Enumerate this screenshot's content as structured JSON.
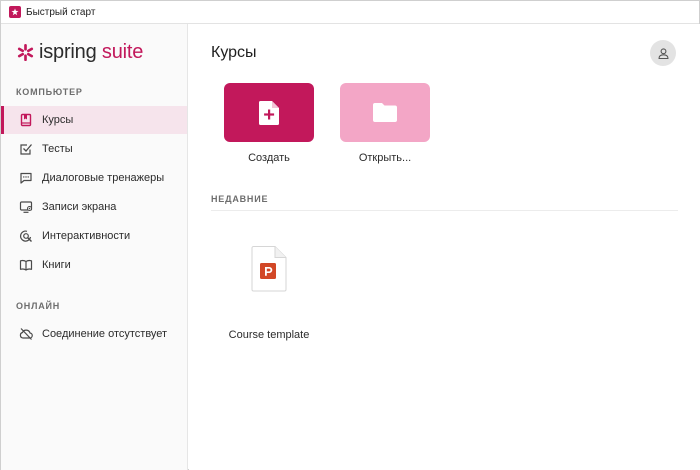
{
  "window": {
    "title": "Быстрый старт",
    "app_icon": "ispring-app-icon"
  },
  "brand": {
    "part1": "ispring",
    "part2": " suite",
    "accent_color": "#c2185b"
  },
  "sidebar": {
    "section_computer": "КОМПЬЮТЕР",
    "items": [
      {
        "label": "Курсы",
        "icon": "book-icon",
        "active": true
      },
      {
        "label": "Тесты",
        "icon": "checkbox-icon",
        "active": false
      },
      {
        "label": "Диалоговые тренажеры",
        "icon": "chat-icon",
        "active": false
      },
      {
        "label": "Записи экрана",
        "icon": "screen-record-icon",
        "active": false
      },
      {
        "label": "Интерактивности",
        "icon": "interaction-icon",
        "active": false
      },
      {
        "label": "Книги",
        "icon": "open-book-icon",
        "active": false
      }
    ],
    "section_online": "ОНЛАЙН",
    "online_items": [
      {
        "label": "Соединение отсутствует",
        "icon": "cloud-off-icon"
      }
    ]
  },
  "main": {
    "title": "Курсы",
    "actions": [
      {
        "label": "Создать",
        "icon": "new-document-icon",
        "color": "#c2185b"
      },
      {
        "label": "Открыть...",
        "icon": "folder-icon",
        "color": "#f3a6c6"
      }
    ],
    "recent_label": "НЕДАВНИЕ",
    "recent_files": [
      {
        "name": "Course template",
        "icon": "powerpoint-file-icon"
      }
    ]
  }
}
